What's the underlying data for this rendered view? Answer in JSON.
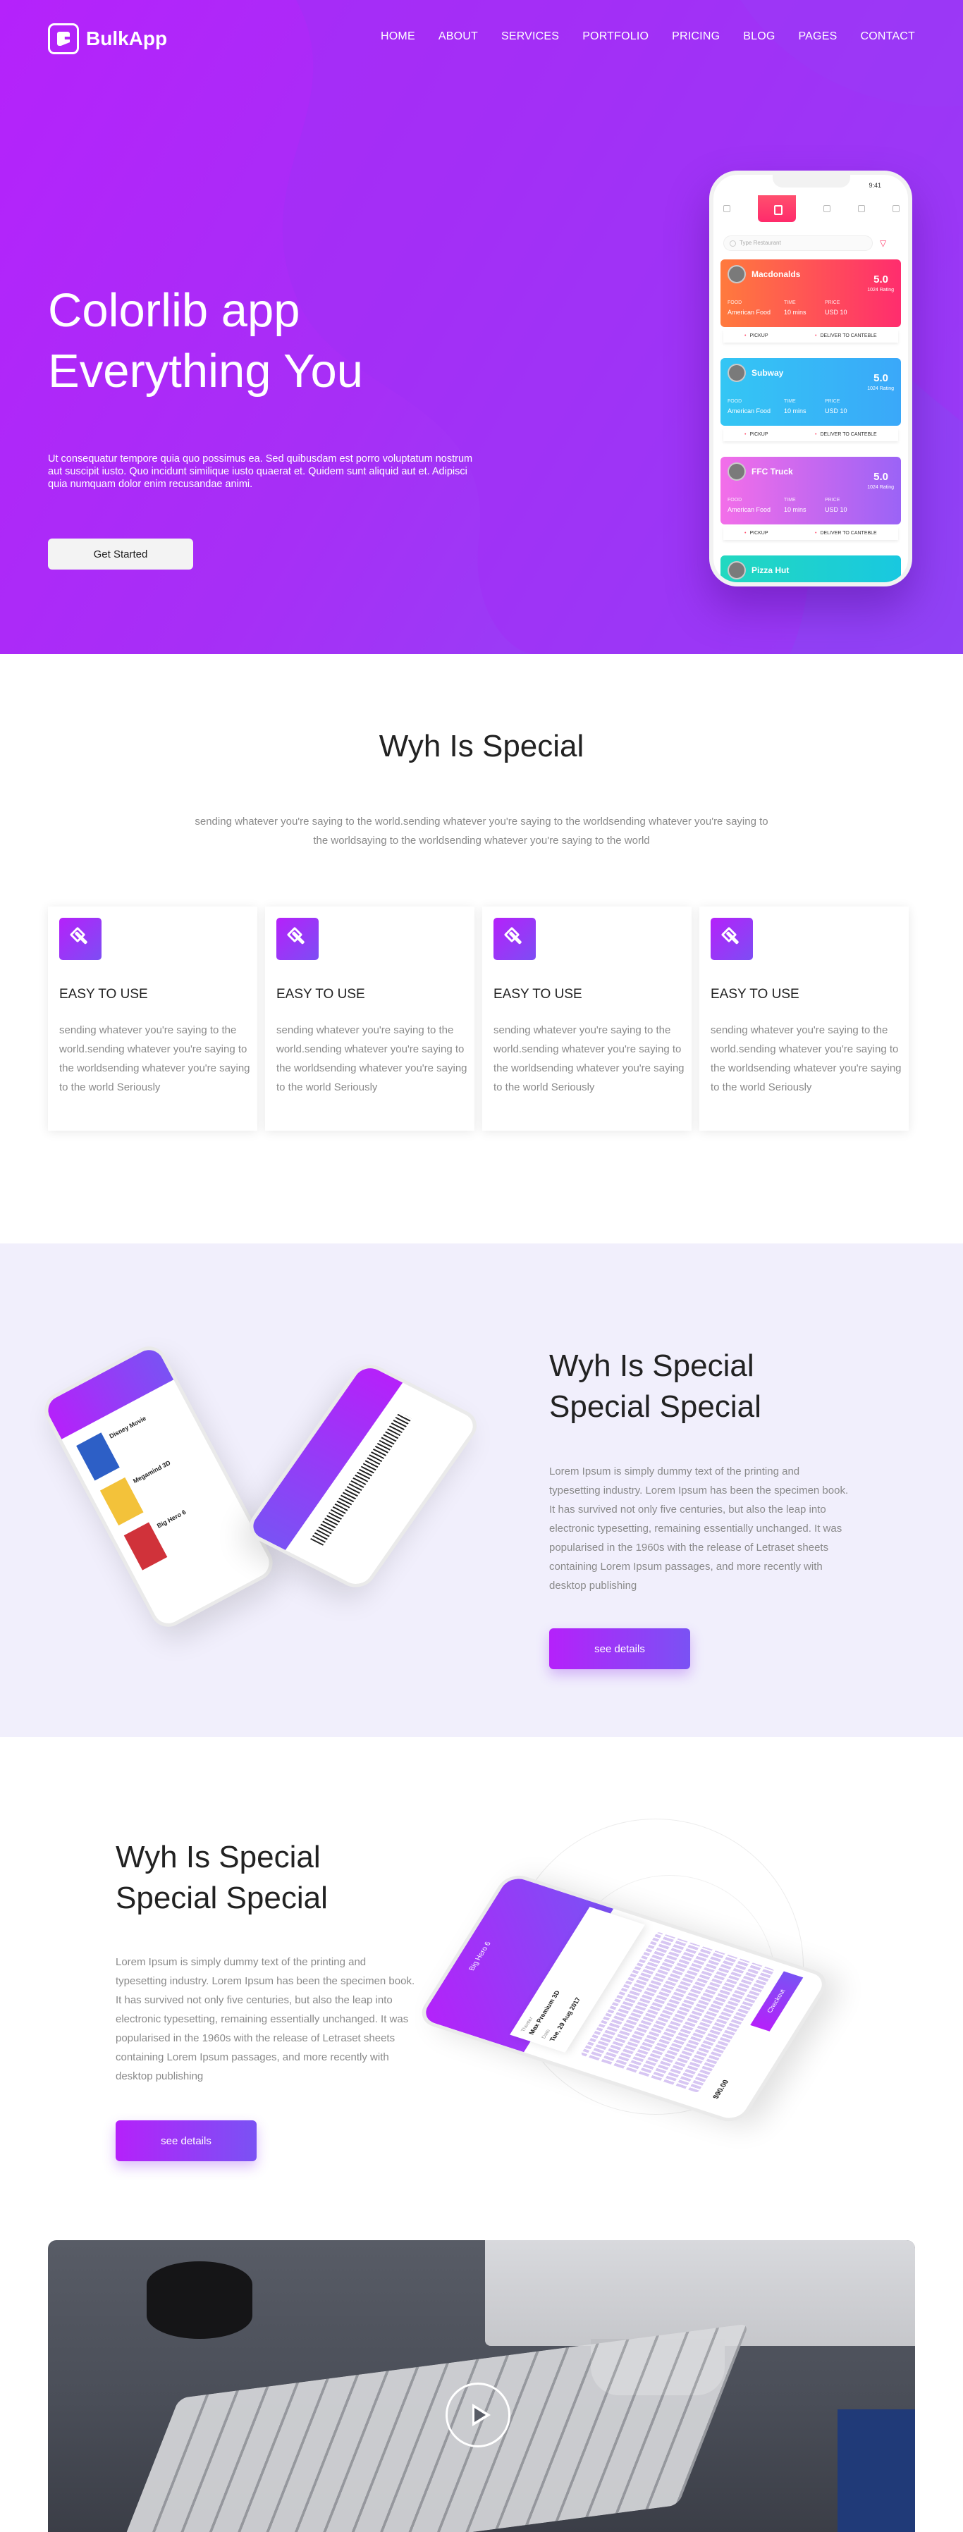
{
  "colors": {
    "brand_gradient_start": "#b521fa",
    "brand_gradient_end": "#7a52f4",
    "lavender_bg": "#f1effc"
  },
  "nav": {
    "logo": "BulkApp",
    "items": [
      "HOME",
      "ABOUT",
      "SERVICES",
      "PORTFOLIO",
      "PRICING",
      "BLOG",
      "PAGES",
      "CONTACT"
    ]
  },
  "hero": {
    "title_line1": "Colorlib app",
    "title_line2": "Everything You",
    "description": "Ut consequatur tempore quia quo possimus ea. Sed quibusdam est porro voluptatum nostrum aut suscipit iusto. Quo incidunt similique iusto quaerat et. Quidem sunt aliquid aut et. Adipisci quia numquam dolor enim recusandae animi.",
    "cta": "Get Started"
  },
  "phone": {
    "time": "9:41",
    "search_placeholder": "Type Restaurant",
    "filter_icon": "filter-icon",
    "cards": [
      {
        "name": "Macdonalds",
        "rating": "5.0",
        "rating_label": "1024 Rating",
        "food_label": "FOOD",
        "time_label": "TIME",
        "price_label": "PRICE",
        "food": "American Food",
        "time": "10 mins",
        "price": "USD 10",
        "pickup": "PICKUP",
        "deliver": "DELIVER TO CANTEBLE",
        "color_start": "#ff7a3d",
        "color_end": "#ff2d6e"
      },
      {
        "name": "Subway",
        "rating": "5.0",
        "rating_label": "1024 Rating",
        "food_label": "FOOD",
        "time_label": "TIME",
        "price_label": "PRICE",
        "food": "American Food",
        "time": "10 mins",
        "price": "USD 10",
        "pickup": "PICKUP",
        "deliver": "DELIVER TO CANTEBLE",
        "color_start": "#34c6f4",
        "color_end": "#3aa8f9"
      },
      {
        "name": "FFC Truck",
        "rating": "5.0",
        "rating_label": "1024 Rating",
        "food_label": "FOOD",
        "time_label": "TIME",
        "price_label": "PRICE",
        "food": "American Food",
        "time": "10 mins",
        "price": "USD 10",
        "pickup": "PICKUP",
        "deliver": "DELIVER TO CANTEBLE",
        "color_start": "#f36ee9",
        "color_end": "#9b63f6"
      },
      {
        "name": "Pizza Hut",
        "color_start": "#22d8c0",
        "color_end": "#19c8e0"
      }
    ]
  },
  "special": {
    "title": "Wyh Is Special",
    "subtitle": "sending whatever you're saying to the world.sending whatever you're saying to the worldsending whatever you're saying to the worldsaying to the worldsending whatever you're saying to the world",
    "features": [
      {
        "title": "EASY TO USE",
        "text": "sending whatever you're saying to the world.sending whatever you're saying to the worldsending whatever you're saying to the world Seriously"
      },
      {
        "title": "EASY TO USE",
        "text": "sending whatever you're saying to the world.sending whatever you're saying to the worldsending whatever you're saying to the world Seriously"
      },
      {
        "title": "EASY TO USE",
        "text": "sending whatever you're saying to the world.sending whatever you're saying to the worldsending whatever you're saying to the world Seriously"
      },
      {
        "title": "EASY TO USE",
        "text": "sending whatever you're saying to the world.sending whatever you're saying to the worldsending whatever you're saying to the world Seriously"
      }
    ]
  },
  "block1": {
    "title_line1": "Wyh Is Special",
    "title_line2": "Special Special",
    "text": "Lorem Ipsum is simply dummy text of the printing and typesetting industry. Lorem Ipsum has been the specimen book. It has survived not only five centuries, but also the leap into electronic typesetting, remaining essentially unchanged. It was popularised in the 1960s with the release of Letraset sheets containing Lorem Ipsum passages, and more recently with desktop publishing",
    "button": "see details",
    "mock_movies": [
      "Disney Movie",
      "Megamind 3D",
      "Big Hero 6"
    ]
  },
  "block2": {
    "title_line1": "Wyh Is Special",
    "title_line2": "Special Special",
    "text": "Lorem Ipsum is simply dummy text of the printing and typesetting industry. Lorem Ipsum has been the specimen book. It has survived not only five centuries, but also the leap into electronic typesetting, remaining essentially unchanged. It was popularised in the 1960s with the release of Letraset sheets containing Lorem Ipsum passages, and more recently with desktop publishing",
    "button": "see details",
    "mock_header": "Big Hero 6",
    "mock_theater_label": "Theater",
    "mock_theater": "Max Premium 3D",
    "mock_date_label": "Date",
    "mock_date": "Tue, 29 Aug 2017",
    "mock_price": "$90.00",
    "mock_checkout": "Checkout"
  },
  "video": {
    "play_icon": "play-icon"
  }
}
